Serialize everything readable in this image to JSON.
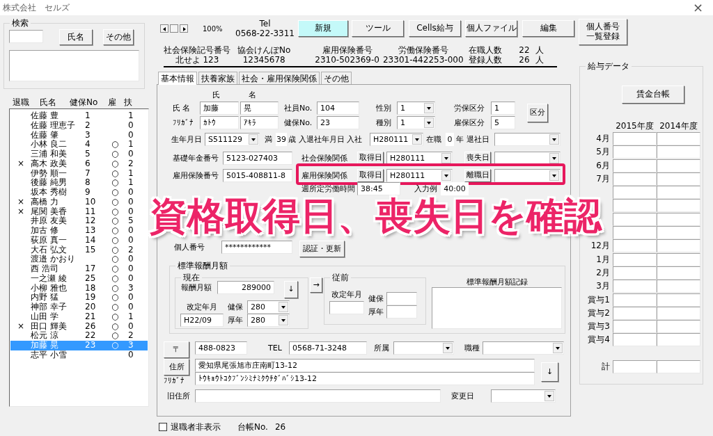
{
  "window": {
    "title": "株式会社　セルズ",
    "close": "×"
  },
  "search": {
    "title": "検索",
    "buttons": [
      "氏名",
      "その他"
    ]
  },
  "employee_list": {
    "columns": [
      "退職",
      "氏名",
      "健保No",
      "雇",
      "扶"
    ],
    "rows": [
      {
        "name": "佐藤 豊",
        "health_no": "1",
        "dependents": "1",
        "selected": false
      },
      {
        "name": "佐藤 理恵子",
        "health_no": "2",
        "dependents": "0",
        "selected": false
      },
      {
        "name": "佐藤 肇",
        "health_no": "3",
        "dependents": "0",
        "selected": false
      },
      {
        "name": "小林 良二",
        "health_no": "4",
        "employment": "○",
        "dependents": "1",
        "selected": false
      },
      {
        "name": "三浦 和美",
        "health_no": "5",
        "employment": "○",
        "dependents": "0",
        "selected": false
      },
      {
        "retired": "×",
        "name": "高木 政美",
        "health_no": "6",
        "employment": "○",
        "dependents": "2",
        "selected": false
      },
      {
        "name": "伊勢 順一",
        "health_no": "7",
        "employment": "○",
        "dependents": "1",
        "selected": false
      },
      {
        "name": "後藤 純男",
        "health_no": "8",
        "employment": "○",
        "dependents": "1",
        "selected": false
      },
      {
        "name": "坂本 秀樹",
        "health_no": "9",
        "employment": "○",
        "dependents": "0",
        "selected": false
      },
      {
        "retired": "×",
        "name": "高橋 力",
        "health_no": "10",
        "employment": "○",
        "dependents": "0",
        "selected": false
      },
      {
        "retired": "×",
        "name": "尾関 美香",
        "health_no": "11",
        "employment": "○",
        "dependents": "0",
        "selected": false
      },
      {
        "name": "井原 友美",
        "health_no": "12",
        "employment": "○",
        "dependents": "5",
        "selected": false
      },
      {
        "name": "加古 修",
        "health_no": "13",
        "employment": "○",
        "dependents": "0",
        "selected": false
      },
      {
        "name": "荻原 真一",
        "health_no": "14",
        "employment": "○",
        "dependents": "0",
        "selected": false
      },
      {
        "name": "大石 弘文",
        "health_no": "15",
        "employment": "○",
        "dependents": "2",
        "selected": false
      },
      {
        "name": "渡邉 かおり",
        "employment": "○",
        "dependents": "0",
        "selected": false
      },
      {
        "name": "西 浩司",
        "health_no": "17",
        "employment": "○",
        "dependents": "0",
        "selected": false
      },
      {
        "name": "一之瀬 綾",
        "health_no": "25",
        "employment": "○",
        "dependents": "0",
        "selected": false
      },
      {
        "name": "小柳 雅也",
        "health_no": "18",
        "employment": "○",
        "dependents": "3",
        "selected": false
      },
      {
        "name": "内野 猛",
        "health_no": "19",
        "employment": "○",
        "dependents": "0",
        "selected": false
      },
      {
        "name": "神部 幸子",
        "health_no": "20",
        "employment": "○",
        "dependents": "0",
        "selected": false
      },
      {
        "name": "山田 学",
        "health_no": "21",
        "employment": "○",
        "dependents": "1",
        "selected": false
      },
      {
        "retired": "×",
        "name": "田口 輝美",
        "health_no": "26",
        "employment": "○",
        "dependents": "0",
        "selected": false
      },
      {
        "name": "松元 涼",
        "health_no": "22",
        "employment": "○",
        "dependents": "2",
        "selected": false
      },
      {
        "name": "加藤 晃",
        "health_no": "23",
        "employment": "○",
        "dependents": "3",
        "selected": true
      },
      {
        "name": "志平 小雪",
        "dependents": "0",
        "selected": false
      }
    ]
  },
  "toolbar": {
    "zoom": "100%",
    "tel_label": "Tel",
    "tel": "0568-22-3311",
    "buttons": [
      {
        "lines": [
          "新規"
        ],
        "highlighted": true
      },
      {
        "lines": [
          "ツール"
        ],
        "highlighted": false
      },
      {
        "lines": [
          "Cells給与"
        ],
        "highlighted": false
      },
      {
        "lines": [
          "個人ファイル"
        ],
        "highlighted": false
      },
      {
        "lines": [
          "編集"
        ],
        "highlighted": false
      },
      {
        "lines": [
          "個人番号",
          "一覧登録"
        ],
        "highlighted": false
      }
    ]
  },
  "insurance_numbers": [
    {
      "label": "社会保険記号番号",
      "value": "北せよ 123"
    },
    {
      "label": "協会けんぽNo",
      "value": "12345678"
    },
    {
      "label": "雇用保険番号",
      "value": "2310-502369-0"
    },
    {
      "label": "労働保険番号",
      "value": "23301-442253-000"
    }
  ],
  "headcounts": [
    {
      "label": "在職人数",
      "count": "22",
      "unit": "人"
    },
    {
      "label": "登録人数",
      "count": "26",
      "unit": "人"
    }
  ],
  "tabs": [
    {
      "label": "基本情報",
      "selected": true
    },
    {
      "label": "扶養家族",
      "selected": false
    },
    {
      "label": "社会・雇用保険関係",
      "selected": false
    },
    {
      "label": "その他",
      "selected": false
    }
  ],
  "form": {
    "name_headers": [
      "氏",
      "名"
    ],
    "rows": [
      {
        "highlighted": false,
        "items": [
          {
            "kind": "label",
            "text": "氏 名"
          },
          {
            "kind": "field",
            "value": "加藤"
          },
          {
            "kind": "field",
            "value": "晃"
          },
          {
            "kind": "label",
            "text": "社員No."
          },
          {
            "kind": "field",
            "value": "104"
          },
          {
            "kind": "label",
            "text": "性別"
          },
          {
            "kind": "select",
            "value": "1"
          },
          {
            "kind": "label",
            "text": "労保区分"
          },
          {
            "kind": "field",
            "value": "1"
          },
          {
            "kind": "button",
            "text": "区分"
          }
        ]
      },
      {
        "highlighted": false,
        "items": [
          {
            "kind": "label",
            "text": "ﾌﾘｶﾞﾅ"
          },
          {
            "kind": "field",
            "value": "ｶﾄｳ"
          },
          {
            "kind": "field",
            "value": "ｱｷﾗ"
          },
          {
            "kind": "label",
            "text": "健保No."
          },
          {
            "kind": "field",
            "value": "23"
          },
          {
            "kind": "label",
            "text": "種別"
          },
          {
            "kind": "select",
            "value": "1"
          },
          {
            "kind": "label",
            "text": "雇保区分"
          },
          {
            "kind": "field",
            "value": "5"
          }
        ]
      },
      {
        "highlighted": false,
        "items": [
          {
            "kind": "label",
            "text": "生年月日"
          },
          {
            "kind": "select",
            "value": "S511129"
          },
          {
            "kind": "label",
            "text": "満"
          },
          {
            "kind": "text",
            "value": "39"
          },
          {
            "kind": "label",
            "text": "歳"
          },
          {
            "kind": "label",
            "text": "入退社年月日 入社"
          },
          {
            "kind": "select",
            "value": "H280111"
          },
          {
            "kind": "label",
            "text": "在職"
          },
          {
            "kind": "text",
            "value": "0"
          },
          {
            "kind": "label",
            "text": "年"
          },
          {
            "kind": "label",
            "text": "退社日"
          },
          {
            "kind": "select"
          }
        ]
      },
      {
        "highlighted": false,
        "items": [
          {
            "kind": "label",
            "text": "基礎年金番号"
          },
          {
            "kind": "field",
            "value": "5123-027403"
          },
          {
            "kind": "label",
            "text": "社会保険関係"
          },
          {
            "kind": "button",
            "text": "取得日"
          },
          {
            "kind": "select",
            "value": "H280111"
          },
          {
            "kind": "button",
            "text": "喪失日"
          },
          {
            "kind": "select"
          }
        ]
      },
      {
        "highlighted": true,
        "items": [
          {
            "kind": "label",
            "text": "雇用保険番号"
          },
          {
            "kind": "field",
            "value": "5015-408811-8"
          },
          {
            "kind": "label",
            "text": "雇用保険関係"
          },
          {
            "kind": "button",
            "text": "取得日"
          },
          {
            "kind": "select",
            "value": "H280111"
          },
          {
            "kind": "button",
            "text": "離職日"
          },
          {
            "kind": "select"
          }
        ]
      },
      {
        "highlighted": false,
        "items": [
          {
            "kind": "label",
            "text": "週所定労働時間"
          },
          {
            "kind": "field",
            "value": "38:45"
          },
          {
            "kind": "label",
            "text": "入力例"
          },
          {
            "kind": "text",
            "value": "40:00"
          }
        ]
      },
      {
        "highlighted": false,
        "items": [
          {
            "kind": "label",
            "text": "個人番号"
          },
          {
            "kind": "field",
            "value": "************"
          },
          {
            "kind": "button",
            "text": "認証・更新"
          }
        ]
      },
      {
        "highlighted": false,
        "items": [
          {
            "kind": "button",
            "text": "〒"
          },
          {
            "kind": "field",
            "value": "488-0823"
          },
          {
            "kind": "label",
            "text": "TEL"
          },
          {
            "kind": "field",
            "value": "0568-71-3248"
          },
          {
            "kind": "label",
            "text": "所属"
          },
          {
            "kind": "select"
          },
          {
            "kind": "label",
            "text": "職種"
          },
          {
            "kind": "select"
          }
        ]
      }
    ]
  },
  "standard_remuneration": {
    "title": "標準報酬月額",
    "current": {
      "title": "現在",
      "amount_label": "報酬月額",
      "amount": "289000",
      "down_button": "↓",
      "revision_label": "改定年月",
      "revision": "H22/09",
      "health_label": "健保",
      "health": "280",
      "pension_label": "厚年",
      "pension": "280"
    },
    "transfer_button": "→",
    "previous": {
      "title": "従前",
      "revision_label": "改定年月",
      "health_label": "健保",
      "pension_label": "厚年"
    },
    "record_label": "標準報酬月額記録"
  },
  "address": {
    "button": "住所",
    "kana_label": "ﾌﾘｶﾞﾅ",
    "address": "愛知県尾張旭市庄南町13-12",
    "kana": "ﾄｳｷｮｳﾄｺｸﾌﾞﾝｼﾐﾅﾐｸｳﾁﾀﾞﾊﾞｼ13-12",
    "down_button": "↓",
    "old_address_label": "旧住所",
    "change_date_label": "変更日"
  },
  "footer": {
    "hide_retired": {
      "label": "退職者非表示",
      "checked": false
    },
    "ledger_label": "台帳No.",
    "ledger_no": "26"
  },
  "salary_data": {
    "title": "給与データ",
    "ledger_button": "賃金台帳",
    "years": [
      "2015年度",
      "2014年度"
    ],
    "rows": [
      {
        "label": "4月"
      },
      {
        "label": "5月"
      },
      {
        "label": "6月"
      },
      {
        "label": "7月"
      },
      {},
      {},
      {},
      {},
      {
        "label": "12月"
      },
      {
        "label": "1月"
      },
      {
        "label": "2月"
      },
      {
        "label": "3月"
      },
      {
        "label": "賞与1"
      },
      {
        "label": "賞与2"
      },
      {
        "label": "賞与3"
      },
      {
        "label": "賞与4"
      }
    ],
    "total_label": "計"
  },
  "annotation": {
    "text": "資格取得日、喪失日を確認"
  }
}
